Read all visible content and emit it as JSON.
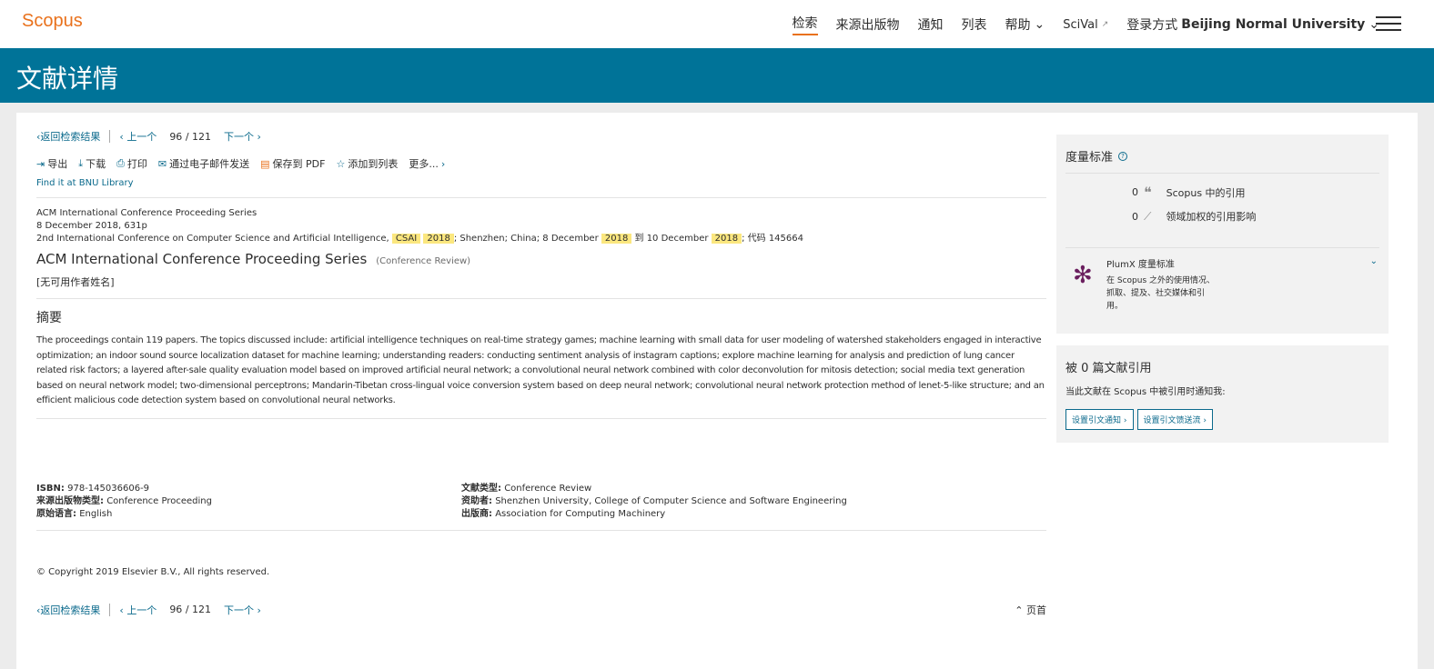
{
  "header": {
    "logo": "Scopus",
    "nav": [
      "检索",
      "来源出版物",
      "通知",
      "列表",
      "帮助",
      "SciVal"
    ],
    "login_prefix": "登录方式",
    "login_institution": "Beijing Normal University"
  },
  "band": {
    "title": "文献详情"
  },
  "pager": {
    "back": "返回检索结果",
    "prev": "上一个",
    "current": "96",
    "separator": "/",
    "total": "121",
    "next": "下一个"
  },
  "actions": [
    "导出",
    "下载",
    "打印",
    "通过电子邮件发送",
    "保存到 PDF",
    "添加到列表",
    "更多..."
  ],
  "library_link": "Find it at BNU Library",
  "source": {
    "series": "ACM International Conference Proceeding Series",
    "date_pages": "8 December 2018, 631p",
    "conf_prefix": "2nd International Conference on Computer Science and Artificial Intelligence,",
    "hl1": "CSAI",
    "hl2": "2018",
    "conf_mid": "; Shenzhen; China; 8 December",
    "hl3": "2018",
    "conf_mid2": "到 10 December",
    "hl4": "2018",
    "conf_suffix": "; 代码 145664"
  },
  "document": {
    "title": "ACM International Conference Proceeding Series",
    "type": "(Conference Review)",
    "authors": "[无可用作者姓名]"
  },
  "abstract": {
    "heading": "摘要",
    "text": "The proceedings contain 119 papers. The topics discussed include: artificial intelligence techniques on real-time strategy games; machine learning with small data for user modeling of watershed stakeholders engaged in interactive optimization; an indoor sound source localization dataset for machine learning; understanding readers: conducting sentiment analysis of instagram captions; explore machine learning for analysis and prediction of lung cancer related risk factors; a layered after-sale quality evaluation model based on improved artificial neural network; a convolutional neural network combined with color deconvolution for mitosis detection; social media text generation based on neural network model; two-dimensional perceptrons; Mandarin-Tibetan cross-lingual voice conversion system based on deep neural network; convolutional neural network protection method of lenet-5-like structure; and an efficient malicious code detection system based on convolutional neural networks."
  },
  "metadata": {
    "isbn_label": "ISBN:",
    "isbn": "978-145036606-9",
    "source_type_label": "来源出版物类型:",
    "source_type": "Conference Proceeding",
    "language_label": "原始语言:",
    "language": "English",
    "doc_type_label": "文献类型:",
    "doc_type": "Conference Review",
    "sponsor_label": "资助者:",
    "sponsor": "Shenzhen University, College of Computer Science and Software Engineering",
    "publisher_label": "出版商:",
    "publisher": "Association for Computing Machinery"
  },
  "copyright": "© Copyright 2019 Elsevier B.V., All rights reserved.",
  "totop": "页首",
  "metrics": {
    "title": "度量标准",
    "citations_count": "0",
    "citations_label": "Scopus 中的引用",
    "fwci_count": "0",
    "fwci_label": "领域加权的引用影响",
    "plumx_title": "PlumX 度量标准",
    "plumx_desc": "在 Scopus 之外的使用情况、抓取、提及、社交媒体和引用。"
  },
  "cited_by": {
    "title": "被 0 篇文献引用",
    "subtitle": "当此文献在 Scopus 中被引用时通知我:",
    "btn_alert": "设置引文通知",
    "btn_feed": "设置引文馈送流"
  },
  "colors": {
    "brand_orange": "#e9711c",
    "band_blue": "#007398",
    "link_blue": "#0b6a8c",
    "highlight": "#fbe77f"
  }
}
